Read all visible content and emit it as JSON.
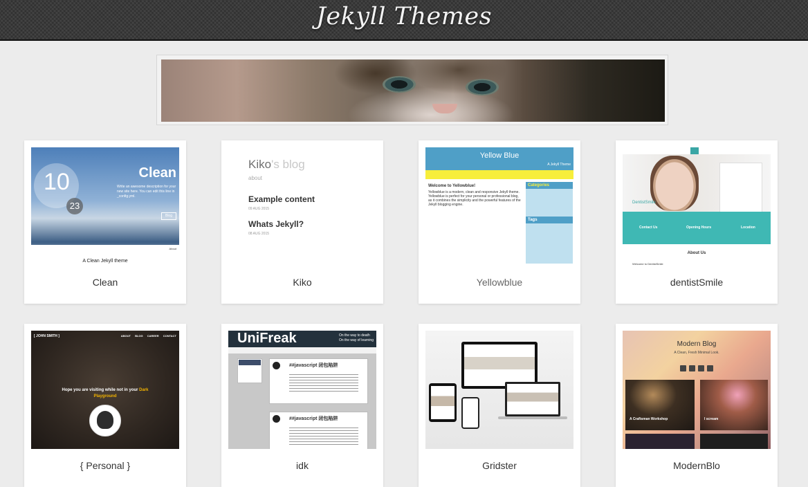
{
  "header": {
    "title": "Jekyll Themes"
  },
  "themes": [
    {
      "name": "Clean"
    },
    {
      "name": "Kiko"
    },
    {
      "name": "Yellowblue"
    },
    {
      "name": "dentistSmile"
    },
    {
      "name": "{ Personal }"
    },
    {
      "name": "idk"
    },
    {
      "name": "Gridster"
    },
    {
      "name": "ModernBlo"
    }
  ],
  "previews": {
    "clean": {
      "day": "10",
      "month_num": "23",
      "title": "Clean",
      "description": "Write an awesome description for your new site here. You can edit this line in _config.yml.",
      "button": "Blog",
      "about": "About",
      "caption": "A Clean Jekyll theme"
    },
    "kiko": {
      "blog_title_a": "Kiko",
      "blog_title_b": "'s blog",
      "about": "about",
      "posts": [
        {
          "title": "Example content",
          "date": "09 AUG 2015"
        },
        {
          "title": "Whats Jekyll?",
          "date": "08 AUG 2015"
        }
      ]
    },
    "yellowblue": {
      "header": "Yellow Blue",
      "subtitle": "A Jekyll Theme",
      "welcome": "Welcome to Yellowblue!",
      "body": "Yellowblue is a modern, clean and responsive Jekyll theme. Yellowblue is perfect for your personal or professional blog, as it combines the simplicity and the powerful features of the Jekyll blogging engine.",
      "categories": "Categories",
      "tags": "Tags"
    },
    "dentist": {
      "brand": "DentistSmile",
      "col1": "Contact Us",
      "col2": "Opening Hours",
      "col3": "Location",
      "about": "About Us",
      "welcome": "Welcome to DentistSmile"
    },
    "personal": {
      "brand": "[ JOHN SMITH ]",
      "menu": "ABOUT BLOG CAREER CONTACT",
      "message_a": "Hope you are visiting while not in your",
      "message_b": "Dark Playground"
    },
    "idk": {
      "logo": "UniFreak",
      "tagline_a": "On the way to death",
      "tagline_b": "On the way of learning",
      "post_title": "##javascript 闭包陷阱"
    },
    "modern": {
      "title": "Modern Blog",
      "subtitle": "A Clean, Fresh Minimal Look.",
      "post1": "A Craftsman Workshop",
      "post2": "I scream"
    }
  }
}
